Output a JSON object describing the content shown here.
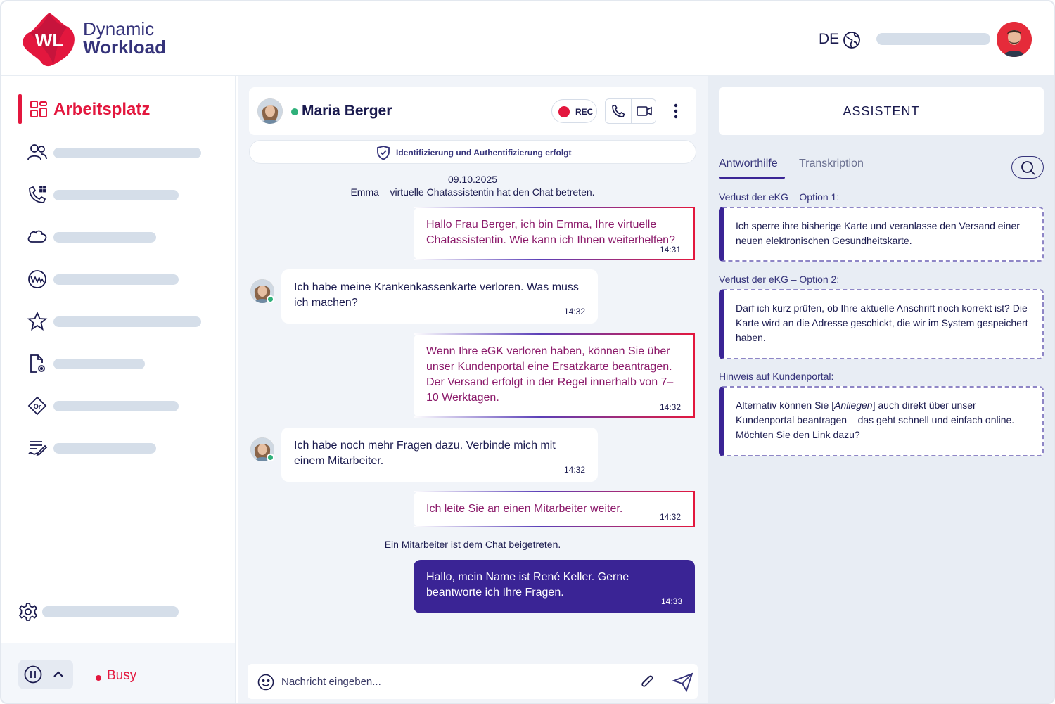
{
  "brand": {
    "line1": "Dynamic",
    "line2": "Workload",
    "logo_text": "WL"
  },
  "header": {
    "language": "DE"
  },
  "sidebar": {
    "active_item": "Arbeitsplatz",
    "items": [
      {
        "icon": "users-icon"
      },
      {
        "icon": "phone-dialpad-icon"
      },
      {
        "icon": "cloud-icon"
      },
      {
        "icon": "vw-icon"
      },
      {
        "icon": "star-icon"
      },
      {
        "icon": "document-settings-icon"
      },
      {
        "icon": "or-tag-icon"
      },
      {
        "icon": "list-edit-icon"
      }
    ],
    "status": "Busy"
  },
  "chat": {
    "contact_name": "Maria Berger",
    "rec_label": "REC",
    "auth_banner": "Identifizierung und Authentifizierung erfolgt",
    "date": "09.10.2025",
    "system_joined_bot": "Emma – virtuelle Chatassistentin hat den Chat betreten.",
    "system_joined_agent": "Ein Mitarbeiter ist dem Chat beigetreten.",
    "messages": [
      {
        "from": "bot",
        "text": "Hallo Frau Berger, ich bin Emma, Ihre virtuelle Chatassistentin. Wie kann ich Ihnen weiterhelfen?",
        "time": "14:31"
      },
      {
        "from": "user",
        "text": "Ich habe meine Krankenkassenkarte verloren. Was muss ich machen?",
        "time": "14:32"
      },
      {
        "from": "bot",
        "text": "Wenn Ihre eGK verloren haben, können Sie über unser Kundenportal eine Ersatzkarte beantragen. Der Versand erfolgt in der Regel innerhalb von 7–10 Werktagen.",
        "time": "14:32"
      },
      {
        "from": "user",
        "text": "Ich habe noch mehr Fragen dazu. Verbinde mich mit einem Mitarbeiter.",
        "time": "14:32"
      },
      {
        "from": "bot",
        "text": "Ich leite Sie an einen Mitarbeiter weiter.",
        "time": "14:32"
      },
      {
        "from": "agent",
        "text": "Hallo, mein Name ist René Keller. Gerne beantworte ich Ihre Fragen.",
        "time": "14:33"
      }
    ],
    "composer_placeholder": "Nachricht eingeben..."
  },
  "assistant": {
    "title": "ASSISTENT",
    "tabs": [
      "Antworthilfe",
      "Transkription"
    ],
    "options": [
      {
        "title": "Verlust der eKG – Option 1:",
        "text": "Ich sperre ihre bisherige Karte und veranlasse den Versand einer neuen elektronischen Gesundheitskarte."
      },
      {
        "title": "Verlust der eKG – Option 2:",
        "text": "Darf ich kurz prüfen, ob Ihre aktuelle Anschrift noch korrekt ist? Die Karte wird an die Adresse geschickt, die wir im System gespeichert haben."
      },
      {
        "title": "Hinweis auf Kundenportal:",
        "text_before": "Alternativ können Sie [",
        "text_italic": "Anliegen",
        "text_after": "] auch direkt über unser Kundenportal beantragen – das geht schnell und einfach online. Möchten Sie den Link dazu?"
      }
    ]
  },
  "colors": {
    "brand_red": "#e3173e",
    "brand_purple": "#3a2495",
    "text_navy": "#1a1a4e"
  }
}
